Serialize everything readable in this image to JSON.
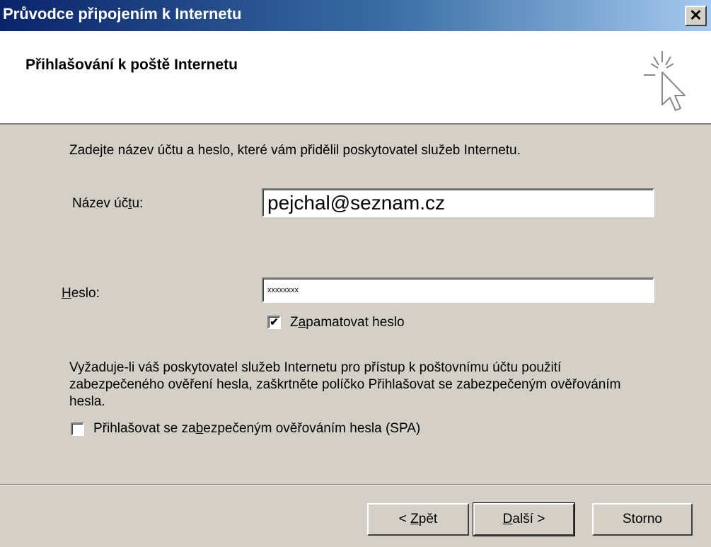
{
  "window": {
    "title": "Průvodce připojením k Internetu",
    "close_glyph": "✕"
  },
  "header": {
    "title": "Přihlašování k poště Internetu",
    "icon": "wizard-cursor-icon"
  },
  "content": {
    "instruction": "Zadejte název účtu a heslo, které vám přidělil poskytovatel služeb Internetu.",
    "account": {
      "label_pre": "Název úč",
      "label_mnemonic": "t",
      "label_post": "u:",
      "value": "pejchal@seznam.cz"
    },
    "password": {
      "label_mnemonic": "H",
      "label_post": "eslo:",
      "value": "xxxxxxxx"
    },
    "remember": {
      "checked": true,
      "check_glyph": "✔",
      "label_pre": "Z",
      "label_mnemonic": "a",
      "label_post": "pamatovat heslo"
    },
    "spa_note": "Vyžaduje-li váš poskytovatel služeb Internetu pro přístup k poštovnímu účtu použití zabezpečeného ověření hesla, zaškrtněte políčko Přihlašovat se zabezpečeným ověřováním hesla.",
    "spa": {
      "checked": false,
      "label_pre": "Přihlašovat se za",
      "label_mnemonic": "b",
      "label_post": "ezpečeným ověřováním hesla (SPA)"
    }
  },
  "buttons": {
    "back": {
      "pre": "< ",
      "mnemonic": "Z",
      "post": "pět"
    },
    "next": {
      "mnemonic": "D",
      "post": "alší >"
    },
    "cancel": "Storno"
  }
}
